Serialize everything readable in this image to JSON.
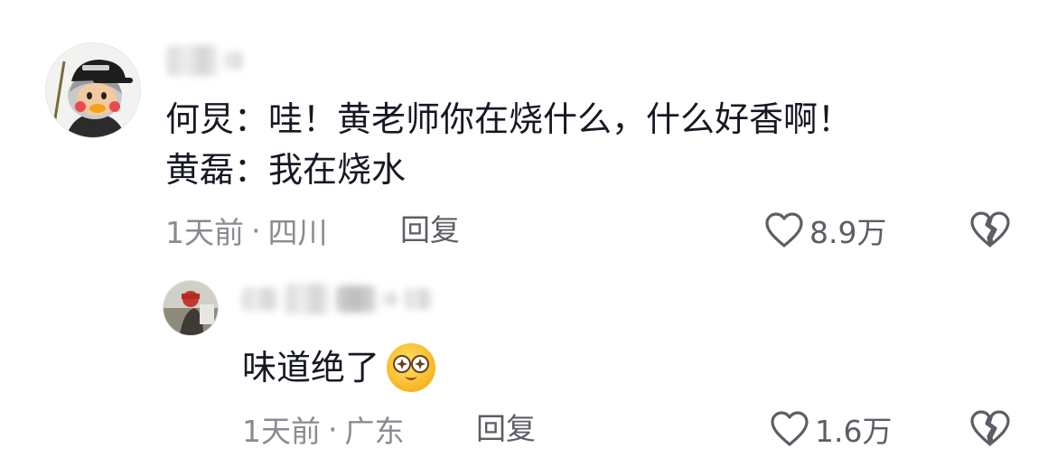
{
  "comments": [
    {
      "avatar_icon": "cartoon-duck-avatar-icon",
      "text_lines": [
        "何炅：哇！黄老师你在烧什么，什么好香啊！",
        "黄磊：我在烧水"
      ],
      "time": "1天前",
      "dot": "·",
      "location": "四川",
      "reply_label": "回复",
      "like_count": "8.9万"
    },
    {
      "avatar_icon": "photo-avatar-icon",
      "text": "味道绝了",
      "emoji_icon": "starry-eyes-emoji-icon",
      "time": "1天前",
      "dot": "·",
      "location": "广东",
      "reply_label": "回复",
      "like_count": "1.6万"
    }
  ],
  "colors": {
    "text_primary": "#161823",
    "text_secondary": "#8a8b91",
    "icon_stroke": "#5c5e66"
  }
}
